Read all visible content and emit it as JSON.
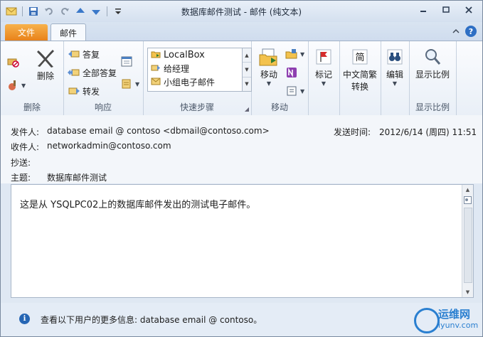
{
  "window": {
    "title": "数据库邮件测试 - 邮件 (纯文本)"
  },
  "tabs": {
    "file": "文件",
    "mail": "邮件"
  },
  "ribbon": {
    "delete_group": {
      "label": "删除",
      "delete_btn": "删除"
    },
    "respond_group": {
      "label": "响应",
      "reply": "答复",
      "reply_all": "全部答复",
      "forward": "转发"
    },
    "quicksteps_group": {
      "label": "快速步骤",
      "items": [
        "LocalBox",
        "给经理",
        "小组电子邮件"
      ]
    },
    "move_group": {
      "label": "移动",
      "move_btn": "移动"
    },
    "tags_group": {
      "label": "",
      "mark_btn": "标记"
    },
    "chinese_group": {
      "label": "",
      "btn_line1": "中文简繁",
      "btn_line2": "转换"
    },
    "edit_group": {
      "label": "",
      "btn": "编辑"
    },
    "zoom_group": {
      "label": "显示比例",
      "btn": "显示比例"
    }
  },
  "header": {
    "from_label": "发件人:",
    "from_value": "database email @ contoso <dbmail@contoso.com>",
    "sent_label": "发送时间:",
    "sent_value": "2012/6/14 (周四) 11:51",
    "to_label": "收件人:",
    "to_value": "networkadmin@contoso.com",
    "cc_label": "抄送:",
    "cc_value": "",
    "subject_label": "主题:",
    "subject_value": "数据库邮件测试"
  },
  "body": {
    "text": "这是从 YSQLPC02上的数据库邮件发出的测试电子邮件。"
  },
  "infobar": {
    "text": "查看以下用户的更多信息: database email @ contoso。"
  },
  "watermark": {
    "name": "运维网",
    "url": "iyunv.com"
  },
  "colors": {
    "file_tab": "#e8821a",
    "accent_blue": "#2e6fc4",
    "flag_red": "#d52b2b"
  }
}
